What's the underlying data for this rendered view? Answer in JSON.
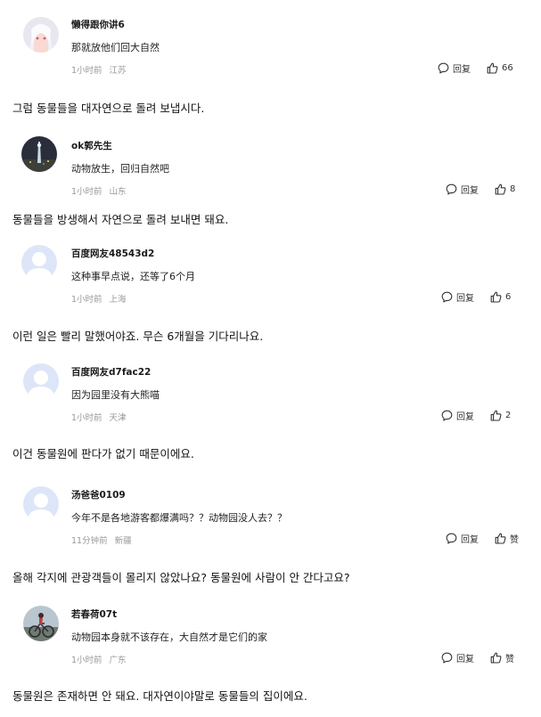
{
  "reply_label": "回复",
  "comments": [
    {
      "name": "懒得跟你讲6",
      "text": "那就放他们回大自然",
      "time": "1小时前",
      "location": "江苏",
      "likes": "66",
      "translation": "그럼 동물들을 대자연으로 돌려 보냅시다.",
      "avatar": "avatar-anime"
    },
    {
      "name": "ok郭先生",
      "text": "动物放生，回归自然吧",
      "time": "1小时前",
      "location": "山东",
      "likes": "8",
      "translation": "동물들을 방생해서 자연으로 돌려 보내면 돼요.",
      "avatar": "avatar-night-tower"
    },
    {
      "name": "百度网友48543d2",
      "text": "这种事早点说，还等了6个月",
      "time": "1小时前",
      "location": "上海",
      "likes": "6",
      "translation": "이런 일은 빨리 말했어야죠. 무슨 6개월을 기다리나요.",
      "avatar": "avatar-default"
    },
    {
      "name": "百度网友d7fac22",
      "text": "因为园里没有大熊喵",
      "time": "1小时前",
      "location": "天津",
      "likes": "2",
      "translation": "이건 동물원에 판다가 없기 때문이에요.",
      "avatar": "avatar-default"
    },
    {
      "name": "汤爸爸0109",
      "text": "今年不是各地游客都爆满吗？？动物园没人去？？",
      "time": "11分钟前",
      "location": "新疆",
      "likes": "赞",
      "translation": "올해 각지에 관광객들이 몰리지 않았나요? 동물원에 사람이 안 간다고요?",
      "avatar": "avatar-default"
    },
    {
      "name": "若春荷07t",
      "text": "动物园本身就不该存在，大自然才是它们的家",
      "time": "1小时前",
      "location": "广东",
      "likes": "赞",
      "translation": "동물원은 존재하면 안 돼요. 대자연이야말로 동물들의 집이에요.",
      "avatar": "avatar-cyclist"
    }
  ]
}
